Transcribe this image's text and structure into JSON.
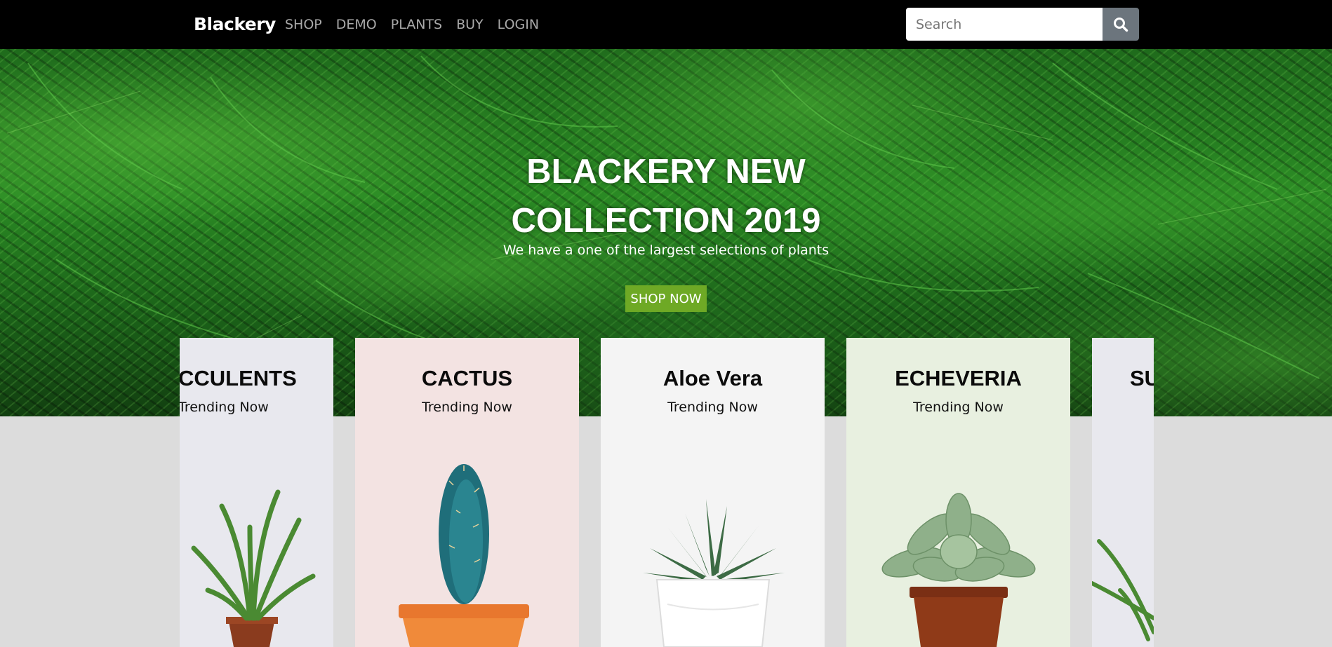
{
  "nav": {
    "brand": "Blackery",
    "links": [
      "SHOP",
      "DEMO",
      "PLANTS",
      "BUY",
      "LOGIN"
    ],
    "search_placeholder": "Search",
    "search_icon": "search-icon"
  },
  "hero": {
    "title_line1": "BLACKERY NEW",
    "title_line2": "COLLECTION 2019",
    "subtitle": "We have a one of the largest selections of plants",
    "button_label": "SHOP NOW",
    "button_color": "#6ea925"
  },
  "cards": [
    {
      "title": "CCULENTS",
      "subtitle": "Trending Now",
      "bg": "#e8e8ee"
    },
    {
      "title": "CACTUS",
      "subtitle": "Trending Now",
      "bg": "#f3e3e2"
    },
    {
      "title": "Aloe Vera",
      "subtitle": "Trending Now",
      "bg": "#f4f4f4"
    },
    {
      "title": "ECHEVERIA",
      "subtitle": "Trending Now",
      "bg": "#e8f0e0"
    },
    {
      "title": "SU",
      "subtitle": "",
      "bg": "#e8e8ee"
    }
  ]
}
